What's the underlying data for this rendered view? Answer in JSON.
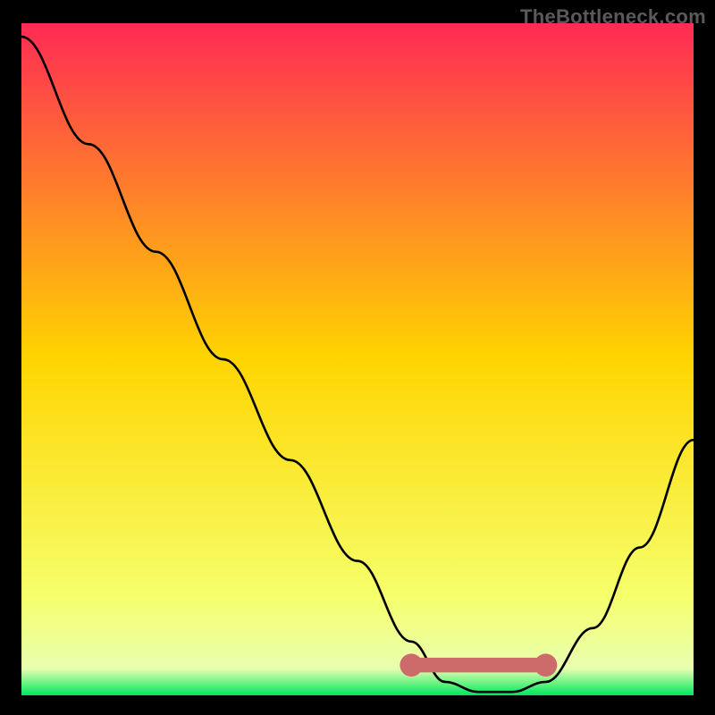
{
  "attribution": "TheBottleneck.com",
  "colors": {
    "bg": "#000000",
    "gradient_stops": [
      {
        "offset": 0,
        "color": "#ff2a55"
      },
      {
        "offset": 0.5,
        "color": "#ffd500"
      },
      {
        "offset": 0.85,
        "color": "#f6ff6a"
      },
      {
        "offset": 0.96,
        "color": "#e9ffb0"
      },
      {
        "offset": 1.0,
        "color": "#00e85e"
      }
    ],
    "curve": "#000000",
    "marker": "#cc6b6a"
  },
  "chart_data": {
    "type": "line",
    "title": "",
    "xlabel": "",
    "ylabel": "",
    "xlim": [
      0,
      100
    ],
    "ylim": [
      0,
      100
    ],
    "grid": false,
    "series": [
      {
        "name": "bottleneck-curve",
        "x": [
          0,
          10,
          20,
          30,
          40,
          50,
          58,
          63,
          68,
          73,
          78,
          85,
          92,
          100
        ],
        "y": [
          98,
          82,
          66,
          50,
          35,
          20,
          8,
          2,
          0.5,
          0.5,
          2,
          10,
          22,
          38
        ]
      }
    ],
    "marker_segment": {
      "name": "highlight-range",
      "x": [
        58,
        78
      ],
      "y": [
        4.5,
        4.5
      ],
      "endcap_radius": 1.2
    }
  }
}
